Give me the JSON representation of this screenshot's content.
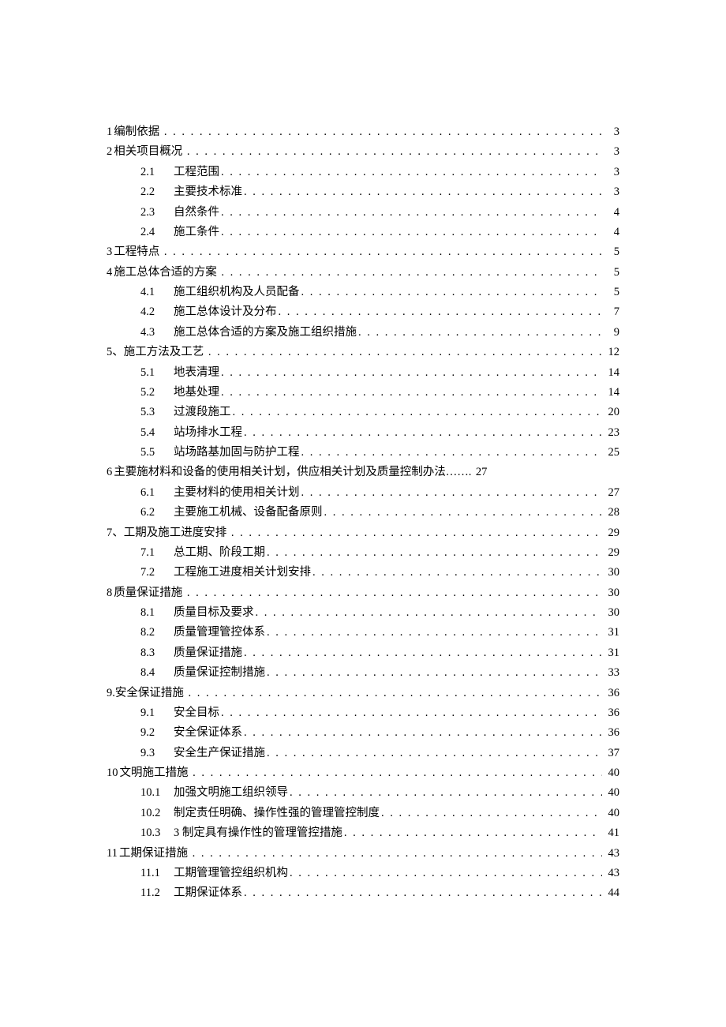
{
  "toc": [
    {
      "level": 1,
      "num": "1",
      "title": "编制依据",
      "page": "3"
    },
    {
      "level": 1,
      "num": "2",
      "title": "相关项目概况",
      "page": "3"
    },
    {
      "level": 2,
      "num": "2.1",
      "title": "工程范围",
      "page": "3"
    },
    {
      "level": 2,
      "num": "2.2",
      "title": "主要技术标准",
      "page": "3"
    },
    {
      "level": 2,
      "num": "2.3",
      "title": "自然条件",
      "page": "4"
    },
    {
      "level": 2,
      "num": "2.4",
      "title": "施工条件",
      "page": "4"
    },
    {
      "level": 1,
      "num": "3",
      "title": "工程特点",
      "page": "5"
    },
    {
      "level": 1,
      "num": "4",
      "title": "施工总体合适的方案",
      "page": "5"
    },
    {
      "level": 2,
      "num": "4.1",
      "title": "施工组织机构及人员配备",
      "page": "5"
    },
    {
      "level": 2,
      "num": "4.2",
      "title": "施工总体设计及分布",
      "page": "7"
    },
    {
      "level": 2,
      "num": "4.3",
      "title": "施工总体合适的方案及施工组织措施",
      "page": "9"
    },
    {
      "level": 1,
      "num": "5、",
      "title": "施工方法及工艺",
      "page": "12"
    },
    {
      "level": 2,
      "num": "5.1",
      "title": "地表清理",
      "page": "14"
    },
    {
      "level": 2,
      "num": "5.2",
      "title": "地基处理",
      "page": "14"
    },
    {
      "level": 2,
      "num": "5.3",
      "title": "过渡段施工",
      "page": "20"
    },
    {
      "level": 2,
      "num": "5.4",
      "title": "站场排水工程",
      "page": "23"
    },
    {
      "level": 2,
      "num": "5.5",
      "title": "站场路基加固与防护工程",
      "page": "25"
    },
    {
      "level": 1,
      "num": "6",
      "title": "主要施材料和设备的使用相关计划，供应相关计划及质量控制办法……",
      "page": "27",
      "no_dots": true
    },
    {
      "level": 2,
      "num": "6.1",
      "title": "主要材料的使用相关计划",
      "page": "27"
    },
    {
      "level": 2,
      "num": "6.2",
      "title": "主要施工机械、设备配备原则",
      "page": "28"
    },
    {
      "level": 1,
      "num": "7、",
      "title": "工期及施工进度安排",
      "page": "29"
    },
    {
      "level": 2,
      "num": "7.1",
      "title": "总工期、阶段工期",
      "page": "29"
    },
    {
      "level": 2,
      "num": "7.2",
      "title": "工程施工进度相关计划安排",
      "page": "30"
    },
    {
      "level": 1,
      "num": "8",
      "title": "质量保证措施",
      "page": "30"
    },
    {
      "level": 2,
      "num": "8.1",
      "title": "质量目标及要求",
      "page": "30"
    },
    {
      "level": 2,
      "num": "8.2",
      "title": "质量管理管控体系",
      "page": "31"
    },
    {
      "level": 2,
      "num": "8.3",
      "title": "质量保证措施",
      "page": "31"
    },
    {
      "level": 2,
      "num": "8.4",
      "title": "质量保证控制措施",
      "page": "33"
    },
    {
      "level": 1,
      "num": "9.",
      "title": "安全保证措施",
      "page": "36"
    },
    {
      "level": 2,
      "num": "9.1",
      "title": "安全目标",
      "page": "36"
    },
    {
      "level": 2,
      "num": "9.2",
      "title": "安全保证体系",
      "page": "36"
    },
    {
      "level": 2,
      "num": "9.3",
      "title": "安全生产保证措施",
      "page": "37"
    },
    {
      "level": 1,
      "num": "10",
      "title": "文明施工措施",
      "page": "40"
    },
    {
      "level": 2,
      "num": "10.1",
      "title": "加强文明施工组织领导",
      "page": "40"
    },
    {
      "level": 2,
      "num": "10.2",
      "title": "制定责任明确、操作性强的管理管控制度",
      "page": "40"
    },
    {
      "level": 2,
      "num": "10.3",
      "title": "3 制定具有操作性的管理管控措施",
      "page": "41"
    },
    {
      "level": 1,
      "num": "11",
      "title": "工期保证措施",
      "page": "43"
    },
    {
      "level": 2,
      "num": "11.1",
      "title": "工期管理管控组织机构",
      "page": "43"
    },
    {
      "level": 2,
      "num": "11.2",
      "title": "工期保证体系",
      "page": "44"
    }
  ]
}
